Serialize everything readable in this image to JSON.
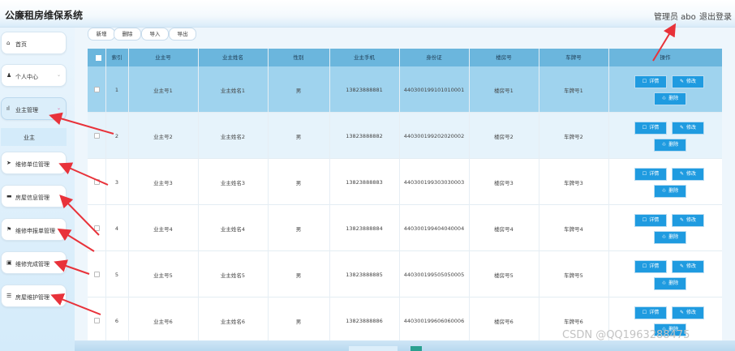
{
  "header": {
    "title": "公廉租房维保系统",
    "user": "管理员 abo",
    "logout": "退出登录"
  },
  "sidebar": {
    "items": [
      {
        "icon": "home-icon",
        "glyph": "⌂",
        "label": "首页",
        "chevron": ""
      },
      {
        "icon": "user-icon",
        "glyph": "♟",
        "label": "个人中心",
        "chevron": "⌄"
      },
      {
        "icon": "bar-chart-icon",
        "glyph": "ıl",
        "label": "业主管理",
        "chevron": "⌄"
      },
      {
        "icon": "send-icon",
        "glyph": "➤",
        "label": "维修单位管理",
        "chevron": ""
      },
      {
        "icon": "folder-icon",
        "glyph": "▬",
        "label": "房屋信息管理",
        "chevron": ""
      },
      {
        "icon": "flag-icon",
        "glyph": "⚑",
        "label": "维修申报单管理",
        "chevron": "⌄"
      },
      {
        "icon": "clipboard-icon",
        "glyph": "▣",
        "label": "维修完成管理",
        "chevron": "⌄"
      },
      {
        "icon": "list-icon",
        "glyph": "☰",
        "label": "房屋维护管理",
        "chevron": "⌄"
      }
    ],
    "submenu_label": "业主"
  },
  "toolbar": {
    "add": "新增",
    "delete": "删除",
    "import": "导入",
    "export": "导出"
  },
  "table": {
    "headers": [
      "索引",
      "业主号",
      "业主姓名",
      "性别",
      "业主手机",
      "身份证",
      "楼房号",
      "车牌号",
      "操作"
    ],
    "rows": [
      {
        "index": "1",
        "owner_no": "业主号1",
        "name": "业主姓名1",
        "gender": "男",
        "phone": "13823888881",
        "id": "440300199101010001",
        "building": "楼房号1",
        "plate": "车牌号1"
      },
      {
        "index": "2",
        "owner_no": "业主号2",
        "name": "业主姓名2",
        "gender": "男",
        "phone": "13823888882",
        "id": "440300199202020002",
        "building": "楼房号2",
        "plate": "车牌号2"
      },
      {
        "index": "3",
        "owner_no": "业主号3",
        "name": "业主姓名3",
        "gender": "男",
        "phone": "13823888883",
        "id": "440300199303030003",
        "building": "楼房号3",
        "plate": "车牌号3"
      },
      {
        "index": "4",
        "owner_no": "业主号4",
        "name": "业主姓名4",
        "gender": "男",
        "phone": "13823888884",
        "id": "440300199404040004",
        "building": "楼房号4",
        "plate": "车牌号4"
      },
      {
        "index": "5",
        "owner_no": "业主号5",
        "name": "业主姓名5",
        "gender": "男",
        "phone": "13823888885",
        "id": "440300199505050005",
        "building": "楼房号5",
        "plate": "车牌号5"
      },
      {
        "index": "6",
        "owner_no": "业主号6",
        "name": "业主姓名6",
        "gender": "男",
        "phone": "13823888886",
        "id": "440300199606060006",
        "building": "楼房号6",
        "plate": "车牌号6"
      }
    ],
    "actions": {
      "detail": "详情",
      "edit": "修改",
      "delete": "删除"
    }
  },
  "watermark": "CSDN @QQ1963288475",
  "colors": {
    "header_row": "#6bb6dd",
    "selected_row": "#9fd3ee",
    "action_button": "#1f9be0",
    "arrow": "#e8323a"
  }
}
